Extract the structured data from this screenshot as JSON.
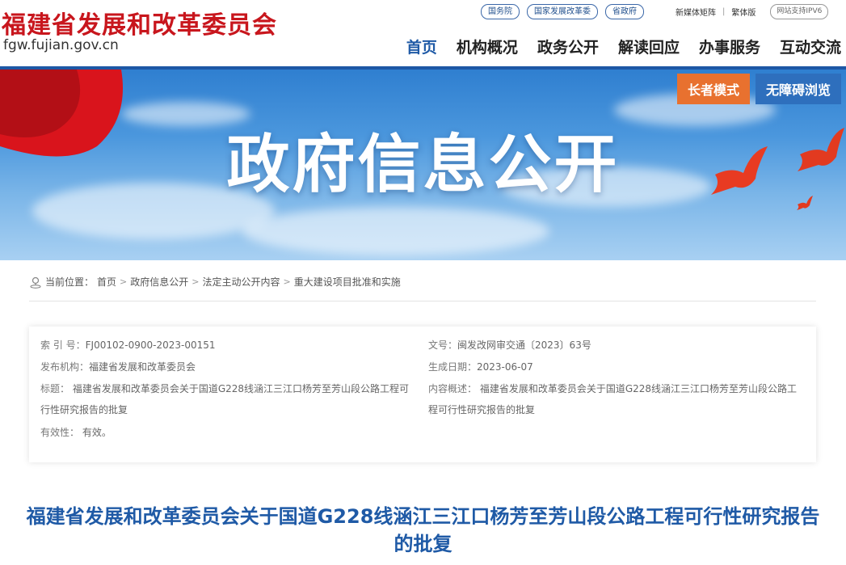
{
  "header": {
    "logo_text": "福建省发展和改革委员会",
    "url": "fgw.fujian.gov.cn",
    "top_links": [
      "国务院",
      "国家发展改革委",
      "省政府"
    ],
    "tools": [
      "新媒体矩阵",
      "繁体版"
    ],
    "tool_sep": "|",
    "ipv6_badge": "网站支持IPV6",
    "nav": [
      {
        "label": "首页",
        "active": true
      },
      {
        "label": "机构概况",
        "active": false
      },
      {
        "label": "政务公开",
        "active": false
      },
      {
        "label": "解读回应",
        "active": false
      },
      {
        "label": "办事服务",
        "active": false
      },
      {
        "label": "互动交流",
        "active": false
      }
    ]
  },
  "banner": {
    "title": "政府信息公开",
    "elder_mode": "长者模式",
    "accessible_browse": "无障碍浏览"
  },
  "breadcrumb": {
    "prefix": "当前位置：",
    "items": [
      "首页",
      "政府信息公开",
      "法定主动公开内容",
      "重大建设项目批准和实施"
    ],
    "arrow": ">"
  },
  "info": {
    "index_label": "索 引 号：",
    "index_value": "FJ00102-0900-2023-00151",
    "doc_no_label": "文号：",
    "doc_no_value": "闽发改网审交通〔2023〕63号",
    "publisher_label": "发布机构：",
    "publisher_value": "福建省发展和改革委员会",
    "date_label": "生成日期：",
    "date_value": "2023-06-07",
    "title_label": "标题：",
    "title_value": "福建省发展和改革委员会关于国道G228线涵江三江口杨芳至芳山段公路工程可行性研究报告的批复",
    "summary_label": "内容概述：",
    "summary_value": "福建省发展和改革委员会关于国道G228线涵江三江口杨芳至芳山段公路工程可行性研究报告的批复",
    "validity_label": "有效性：",
    "validity_value": "有效。"
  },
  "document": {
    "title": "福建省发展和改革委员会关于国道G228线涵江三江口杨芳至芳山段公路工程可行性研究报告的批复"
  },
  "colors": {
    "brand_red": "#c8161d",
    "brand_blue": "#1f5aa6",
    "elder_orange": "#e8712f",
    "access_blue": "#2e6fbd"
  }
}
